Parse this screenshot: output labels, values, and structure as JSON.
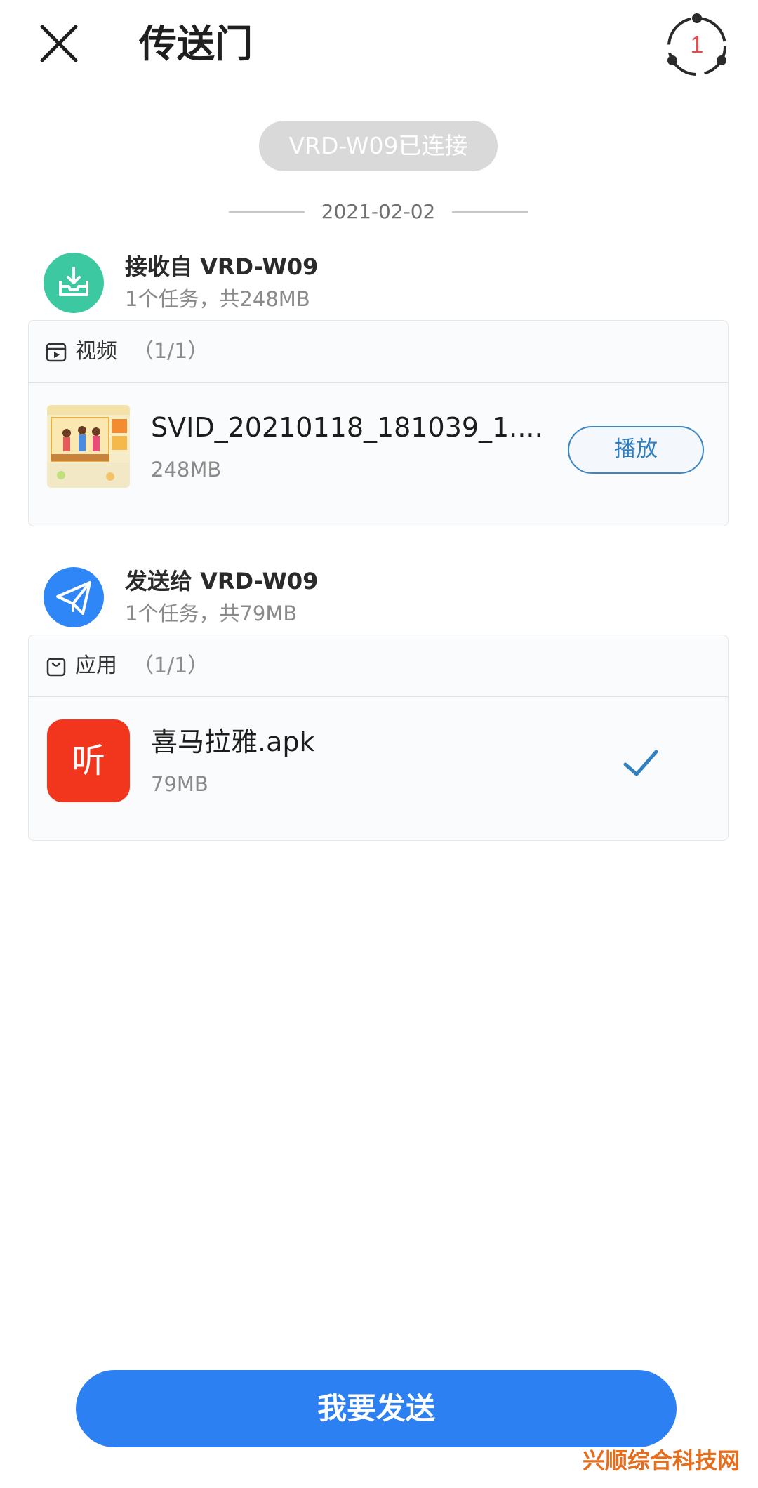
{
  "header": {
    "title": "传送门",
    "share_count": "1"
  },
  "connection": {
    "status": "VRD-W09已连接"
  },
  "date": "2021-02-02",
  "received": {
    "title": "接收自 VRD-W09",
    "subtitle": "1个任务，共248MB",
    "category_label": "视频",
    "category_count": "（1/1）",
    "file": {
      "name": "SVID_20210118_181039_1....",
      "size": "248MB",
      "action_label": "播放"
    }
  },
  "sent": {
    "title": "发送给 VRD-W09",
    "subtitle": "1个任务，共79MB",
    "category_label": "应用",
    "category_count": "（1/1）",
    "file": {
      "name": "喜马拉雅.apk",
      "size": "79MB",
      "app_icon_text": "听",
      "status": "check-icon"
    }
  },
  "footer": {
    "send_label": "我要发送"
  },
  "watermark": "兴顺综合科技网",
  "colors": {
    "accent_blue": "#2c80f2",
    "receive_green": "#3cc8a0",
    "app_red": "#f2361d",
    "badge_red": "#e5484d"
  }
}
